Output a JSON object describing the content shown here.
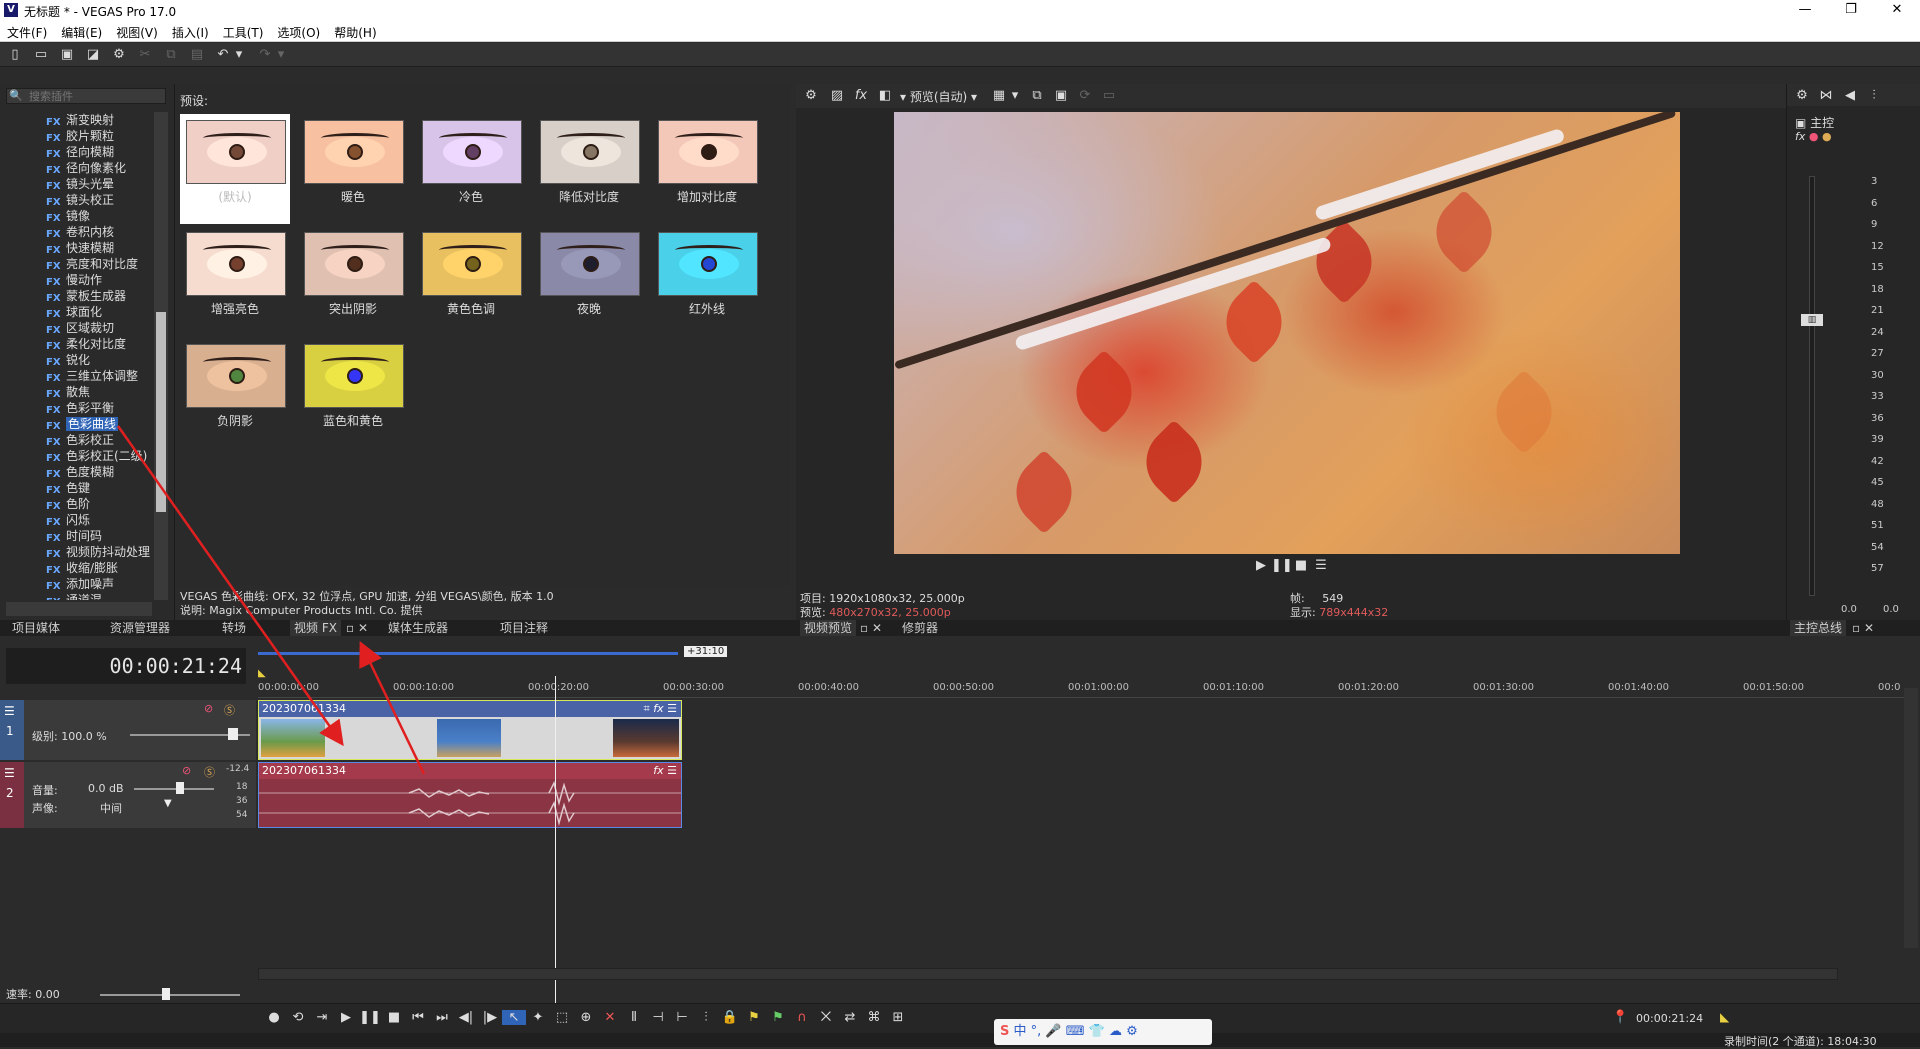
{
  "window": {
    "title": "无标题 * - VEGAS Pro 17.0",
    "logo_letter": "V",
    "controls": [
      "—",
      "❐",
      "✕"
    ]
  },
  "menu": [
    "文件(F)",
    "编辑(E)",
    "视图(V)",
    "插入(I)",
    "工具(T)",
    "选项(O)",
    "帮助(H)"
  ],
  "plugins": {
    "search_placeholder": "搜索插件",
    "fx_tag": "FX",
    "items": [
      "渐变映射",
      "胶片颗粒",
      "径向模糊",
      "径向像素化",
      "镜头光晕",
      "镜头校正",
      "镜像",
      "卷积内核",
      "快速模糊",
      "亮度和对比度",
      "慢动作",
      "蒙板生成器",
      "球面化",
      "区域裁切",
      "柔化对比度",
      "锐化",
      "三维立体调整",
      "散焦",
      "色彩平衡",
      "色彩曲线",
      "色彩校正",
      "色彩校正(二级)",
      "色度模糊",
      "色键",
      "色阶",
      "闪烁",
      "时间码",
      "视频防抖动处理",
      "收缩/膨胀",
      "添加噪声",
      "通道混"
    ],
    "selected_index": 19
  },
  "presets": {
    "title": "预设:",
    "items": [
      {
        "label": "(默认)",
        "tint": "#f0d0c6",
        "iris": "#6a4232"
      },
      {
        "label": "暖色",
        "tint": "#f7c0a0",
        "iris": "#7a4a2a"
      },
      {
        "label": "冷色",
        "tint": "#d8c4e8",
        "iris": "#5a3a5a"
      },
      {
        "label": "降低对比度",
        "tint": "#d8d0c8",
        "iris": "#7a6a5a"
      },
      {
        "label": "增加对比度",
        "tint": "#f3c8b8",
        "iris": "#2a1a12"
      },
      {
        "label": "增强亮色",
        "tint": "#f6dccf",
        "iris": "#6a3a2a"
      },
      {
        "label": "突出阴影",
        "tint": "#e0c0b0",
        "iris": "#4a2a1a"
      },
      {
        "label": "黄色色调",
        "tint": "#e8c060",
        "iris": "#6a5a1a"
      },
      {
        "label": "夜晚",
        "tint": "#8a8aa8",
        "iris": "#1a1a2a"
      },
      {
        "label": "红外线",
        "tint": "#4ad0e8",
        "iris": "#2040c0"
      },
      {
        "label": "负阴影",
        "tint": "#d8b090",
        "iris": "#4a7a3a"
      },
      {
        "label": "蓝色和黄色",
        "tint": "#d8d040",
        "iris": "#3030e0"
      }
    ],
    "info_line1": "VEGAS 色彩曲线: OFX, 32 位浮点, GPU 加速, 分组 VEGAS\\颜色, 版本 1.0",
    "info_line2": "说明: Magix Computer Products Intl. Co. 提供"
  },
  "preview": {
    "toolbar_mode": "预览(自动)",
    "project_label": "项目:",
    "project_value": "1920x1080x32, 25.000p",
    "preview_label": "预览:",
    "preview_value": "480x270x32, 25.000p",
    "frame_label": "帧:",
    "frame_value": "549",
    "display_label": "显示:",
    "display_value": "789x444x32"
  },
  "master": {
    "title": "主控",
    "scale": [
      "3",
      "6",
      "9",
      "12",
      "15",
      "18",
      "21",
      "24",
      "27",
      "30",
      "33",
      "36",
      "39",
      "42",
      "45",
      "48",
      "51",
      "54",
      "57"
    ],
    "val_left": "0.0",
    "val_right": "0.0"
  },
  "tabs_left": [
    "项目媒体",
    "资源管理器",
    "转场",
    "视频 FX",
    "媒体生成器",
    "项目注释"
  ],
  "tabs_preview": [
    "视频预览",
    "修剪器"
  ],
  "tabs_master": "主控总线",
  "timeline": {
    "time": "00:00:21:24",
    "offset_badge": "+31:10",
    "ruler": [
      "00:00:00:00",
      "00:00:10:00",
      "00:00:20:00",
      "00:00:30:00",
      "00:00:40:00",
      "00:00:50:00",
      "00:01:00:00",
      "00:01:10:00",
      "00:01:20:00",
      "00:01:30:00",
      "00:01:40:00",
      "00:01:50:00",
      "00:0"
    ],
    "video_track": {
      "number": "1",
      "level": "级别: 100.0 %",
      "clip_name": "202307061334"
    },
    "audio_track": {
      "number": "2",
      "volume_label": "音量:",
      "volume_value": "0.0 dB",
      "pan_label": "声像:",
      "pan_value": "中间",
      "db_scale": [
        "-12.4",
        "18",
        "36",
        "54"
      ],
      "clip_name": "202307061334"
    },
    "rate": "速率: 0.00",
    "end_time": "00:00:21:24"
  },
  "status": {
    "record_label": "录制时间(2 个通道): 18:04:30",
    "ime": "中"
  },
  "colors": {
    "video_track": "#3a5a8a",
    "audio_track": "#7a3040",
    "selection": "#2f64b6",
    "annotation": "#e02020"
  }
}
